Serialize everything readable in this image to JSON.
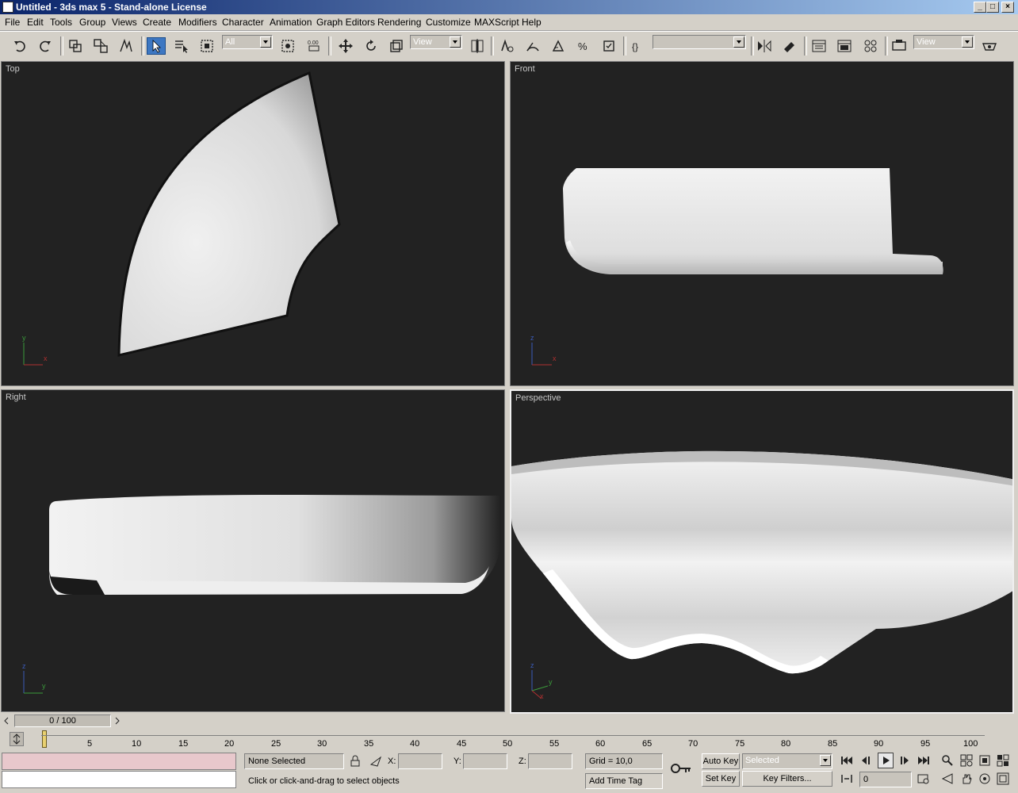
{
  "window": {
    "title": "Untitled - 3ds max 5 - Stand-alone License"
  },
  "menu": [
    "File",
    "Edit",
    "Tools",
    "Group",
    "Views",
    "Create",
    "Modifiers",
    "Character",
    "Animation",
    "Graph Editors",
    "Rendering",
    "Customize",
    "MAXScript",
    "Help"
  ],
  "toolbar": {
    "selection_filter": "All",
    "ref_coord": "View",
    "named_sel": "",
    "render_type": "View"
  },
  "viewports": {
    "top": "Top",
    "front": "Front",
    "right": "Right",
    "perspective": "Perspective"
  },
  "trackbar": {
    "time_display": "0 / 100",
    "ticks": [
      "5",
      "10",
      "15",
      "20",
      "25",
      "30",
      "35",
      "40",
      "45",
      "50",
      "55",
      "60",
      "65",
      "70",
      "75",
      "80",
      "85",
      "90",
      "95",
      "100"
    ]
  },
  "status": {
    "selection": "None Selected",
    "x_label": "X:",
    "y_label": "Y:",
    "z_label": "Z:",
    "x_value": "",
    "y_value": "",
    "z_value": "",
    "grid": "Grid = 10,0",
    "prompt": "Click or click-and-drag to select objects",
    "add_time_tag": "Add Time Tag",
    "auto_key": "Auto Key",
    "set_key": "Set Key",
    "key_mode": "Selected",
    "key_filters": "Key Filters...",
    "current_frame": "0"
  },
  "axis_labels": {
    "x": "x",
    "y": "y",
    "z": "z"
  }
}
